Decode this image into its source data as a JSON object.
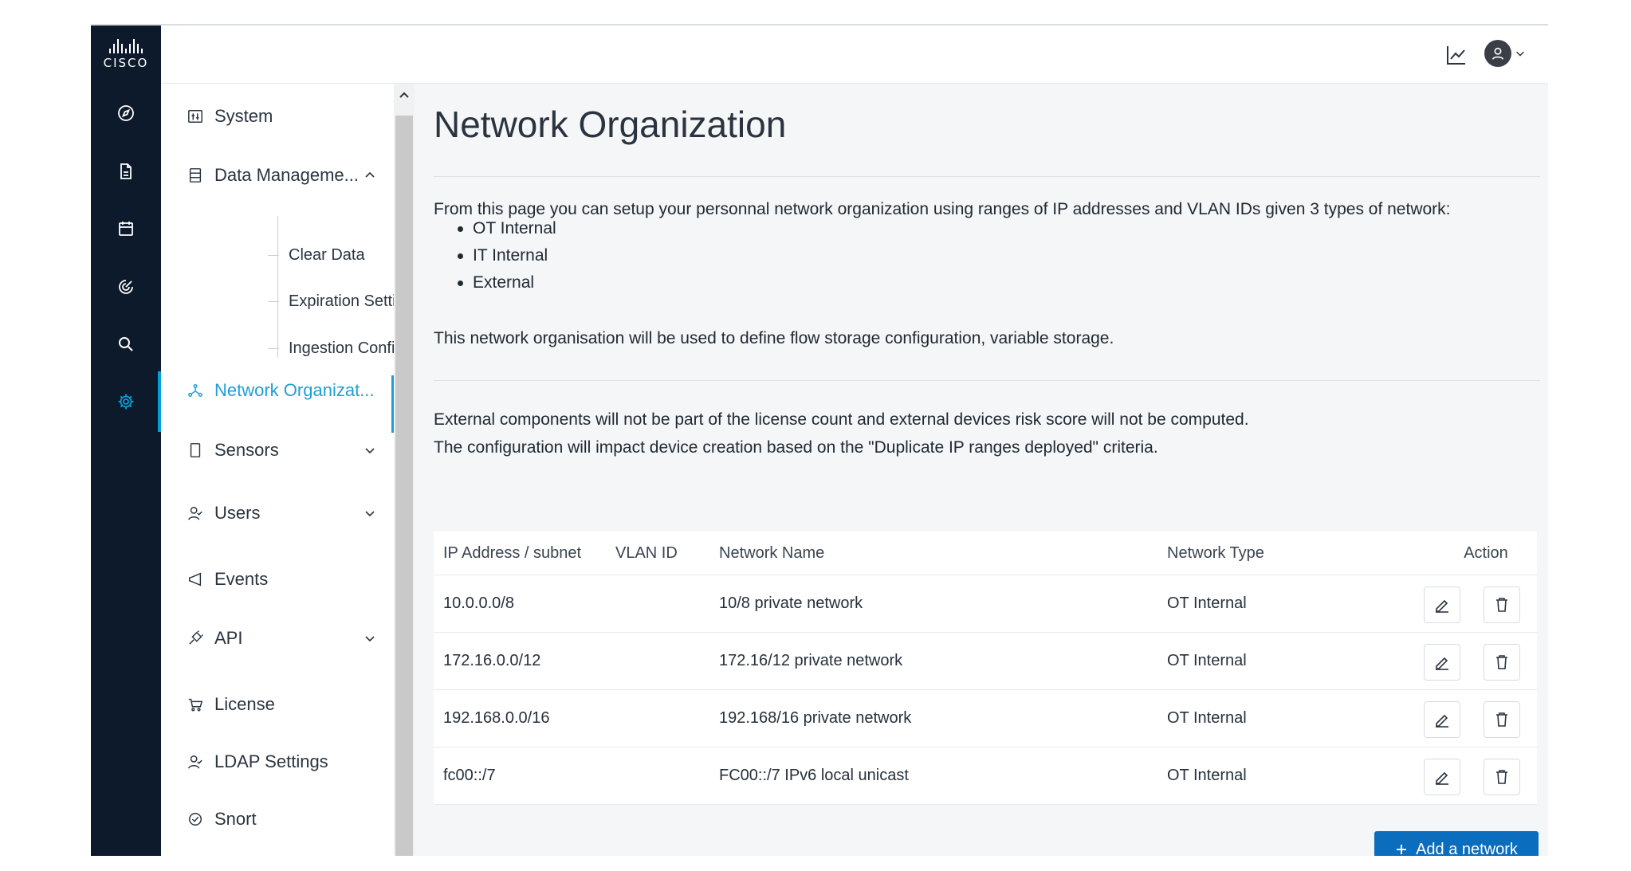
{
  "brand": {
    "logo_text": "CISCO"
  },
  "rail": {
    "items": [
      {
        "icon": "compass-icon"
      },
      {
        "icon": "document-icon"
      },
      {
        "icon": "calendar-icon"
      },
      {
        "icon": "radar-icon"
      },
      {
        "icon": "search-icon"
      },
      {
        "icon": "gear-icon",
        "active": true
      }
    ]
  },
  "header": {
    "chart_icon": "line-chart-icon",
    "user_icon": "user-avatar-icon"
  },
  "nav": {
    "system": "System",
    "data_management": "Data Manageme...",
    "sub": {
      "clear_data": "Clear Data",
      "expiration_settings": "Expiration Settings",
      "ingestion_configuration": "Ingestion Configura..."
    },
    "network_organization": "Network Organizat...",
    "sensors": "Sensors",
    "users": "Users",
    "events": "Events",
    "api": "API",
    "license": "License",
    "ldap_settings": "LDAP Settings",
    "snort": "Snort"
  },
  "main": {
    "title": "Network Organization",
    "intro": "From this page you can setup your personnal network organization using ranges of IP addresses and VLAN IDs given 3 types of network:",
    "network_types": [
      "OT Internal",
      "IT Internal",
      "External"
    ],
    "usage_note": "This network organisation will be used to define flow storage configuration, variable storage.",
    "external_note_1": "External components will not be part of the license count and external devices risk score will not be computed.",
    "external_note_2": "The configuration will impact device creation based on the \"Duplicate IP ranges deployed\" criteria.",
    "table": {
      "headers": {
        "ip": "IP Address / subnet",
        "vlan": "VLAN ID",
        "name": "Network Name",
        "type": "Network Type",
        "action": "Action"
      },
      "rows": [
        {
          "ip": "10.0.0.0/8",
          "vlan": "",
          "name": "10/8 private network",
          "type": "OT Internal"
        },
        {
          "ip": "172.16.0.0/12",
          "vlan": "",
          "name": "172.16/12 private network",
          "type": "OT Internal"
        },
        {
          "ip": "192.168.0.0/16",
          "vlan": "",
          "name": "192.168/16 private network",
          "type": "OT Internal"
        },
        {
          "ip": "fc00::/7",
          "vlan": "",
          "name": "FC00::/7 IPv6 local unicast",
          "type": "OT Internal"
        }
      ]
    },
    "add_button": "Add a network"
  },
  "colors": {
    "rail_bg": "#0c1a2b",
    "accent": "#1f9fd6",
    "primary_button": "#0a6dbd"
  }
}
